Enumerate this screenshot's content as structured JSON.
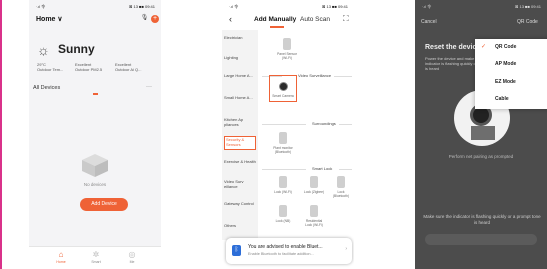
{
  "status_bar": {
    "left": "ᐧ.ıl 令",
    "right": "⊠ 13 ■■ 09:41"
  },
  "screen1": {
    "home_title": "Home ∨",
    "weather": "Sunny",
    "cols": [
      {
        "value": "29°C",
        "label": "Outdoor Tem..."
      },
      {
        "value": "Excellent",
        "label": "Outdoor PM2.5"
      },
      {
        "value": "Excellent",
        "label": "Outdoor Ai Q..."
      }
    ],
    "all_devices": "All Devices",
    "more": "···",
    "no_devices": "No devices",
    "add_device": "Add Device",
    "tabs": [
      {
        "label": "Home",
        "icon": "home-icon"
      },
      {
        "label": "Smart",
        "icon": "sun-icon"
      },
      {
        "label": "Me",
        "icon": "me-icon"
      }
    ]
  },
  "screen2": {
    "title": "Add Manually",
    "tab2": "Auto Scan",
    "categories": [
      "Electrician",
      "Lighting",
      "Large Home A...",
      "Small Home A...",
      "Kitchen Ap pliances",
      "Security & Sensors",
      "Exercise & Health",
      "Video Surv eillance",
      "Gateway Control",
      "Others"
    ],
    "sections": {
      "video": "Video Surveillance",
      "surroundings": "Surroundings",
      "lock": "Smart Lock"
    },
    "devices": {
      "top": "Panel Sensor (Wi-Fi)",
      "camera": "Smart Camera",
      "surround": "Plant monitor (Bluetooth)",
      "locks": [
        "Lock (Wi-Fi)",
        "Lock (Zigbee)",
        "Lock (Bluetooth)",
        "Lock (NB)",
        "Residential Lock (Wi-Fi)"
      ]
    },
    "banner_title": "You are advised to enable Bluet...",
    "banner_sub": "Enable Bluetooth to facilitate addition..."
  },
  "screen3": {
    "cancel": "Cancel",
    "qr": "QR Code",
    "reset": "Reset the device first.",
    "desc": "Power the device and make sure the indicator is flashing quickly or a prompt tone is heard",
    "perform": "Perform net pairing as prompted",
    "bottom": "Make sure the indicator is flashing quickly or a prompt tone is heard",
    "menu": [
      "QR Code",
      "AP Mode",
      "EZ Mode",
      "Cable"
    ],
    "accent": "#ef6236"
  }
}
